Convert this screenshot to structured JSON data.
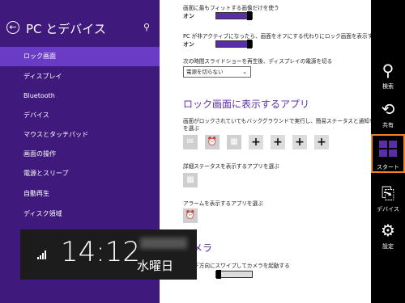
{
  "nav": {
    "title": "PC とデバイス",
    "items": [
      {
        "label": "ロック画面",
        "selected": true
      },
      {
        "label": "ディスプレイ"
      },
      {
        "label": "Bluetooth"
      },
      {
        "label": "デバイス"
      },
      {
        "label": "マウスとタッチパッド"
      },
      {
        "label": "画面の操作"
      },
      {
        "label": "電源とスリープ"
      },
      {
        "label": "自動再生"
      },
      {
        "label": "ディスク領域"
      }
    ]
  },
  "content": {
    "opt1_label": "画面に最もフィットする画像だけを使う",
    "opt1_state": "オン",
    "opt2_label": "PC が非アクティブになったら、画面をオフにする代わりにロック画面を表示する",
    "opt2_state": "オン",
    "opt3_label": "次の時間スライドショーを再生後、ディスプレイの電源を切る",
    "dropdown_value": "電源を切らない",
    "section_apps": "ロック画面に表示するアプリ",
    "apps_desc_1": "画面がロックされていてもバックグラウンドで実行し、簡易ステータスと通知を表示するアプリ",
    "apps_desc_2": "を選ぶ",
    "detail_label": "詳細ステータスを表示するアプリを選ぶ",
    "alarm_label": "アラームを表示するアプリを選ぶ",
    "section_camera": "カメラ",
    "camera_desc": "画面下方向にスワイプしてカメラを起動する"
  },
  "charms": {
    "search": "検索",
    "share": "共有",
    "start": "スタート",
    "devices": "デバイス",
    "settings": "設定"
  },
  "clock": {
    "time": "14:12",
    "weekday": "水曜日"
  },
  "colors": {
    "nav_bg": "#3f1a7c",
    "nav_selected": "#6a3cc6",
    "accent": "#5b2ea6",
    "start_highlight": "#f58220"
  }
}
